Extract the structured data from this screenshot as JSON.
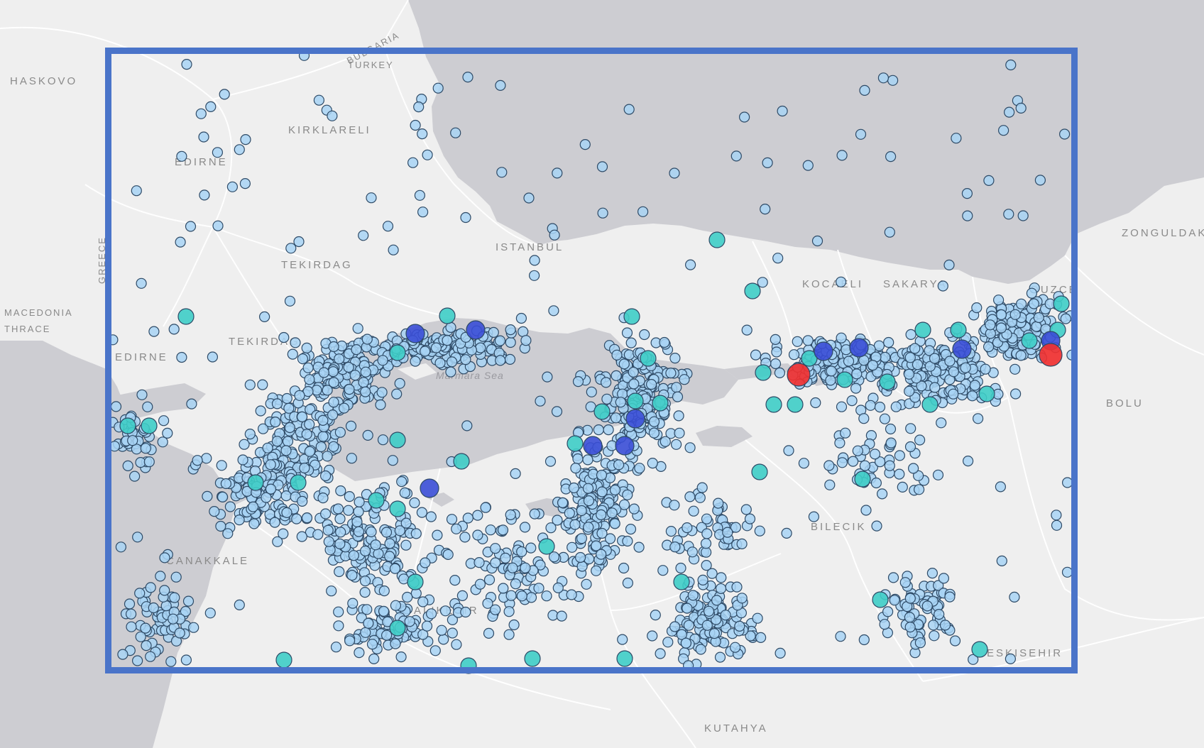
{
  "map": {
    "colors": {
      "land": "#efefef",
      "water": "#cdcdd2",
      "boundary": "#ffffff",
      "label": "#8a8a8a",
      "frame": "#4a74c9",
      "marker_small": "#a8d4f4",
      "marker_medium": "#3ecdc6",
      "marker_large": "#3a4ed6",
      "marker_major": "#f03030",
      "marker_outline": "#2e4a66"
    },
    "labels": {
      "haskovo": "HASKOVO",
      "bulgaria": "BULGARIA",
      "turkey": "TURKEY",
      "kirklareli": "KIRKLARELI",
      "edirne_top": "EDIRNE",
      "greece": "GREECE",
      "tekirdag_top": "TEKIRDAG",
      "istanbul": "ISTANBUL",
      "macedonia": "MACEDONIA",
      "thrace": "THRACE",
      "tekirdag": "TEKIRDAG",
      "edirne": "EDIRNE",
      "marmara": "Marmara Sea",
      "kocaeli": "KOCAELI",
      "sakarya": "SAKARYA",
      "duzce": "DUZCE",
      "zonguldak": "ZONGULDAK",
      "bolu": "BOLU",
      "bilecik": "BILECIK",
      "canakkale": "CANAKKALE",
      "balikesir": "BALIKESIR",
      "eskisehir": "ESKISEHIR",
      "kutahya": "KUTAHYA"
    },
    "marker_classes": [
      "small",
      "medium",
      "large",
      "major"
    ]
  }
}
